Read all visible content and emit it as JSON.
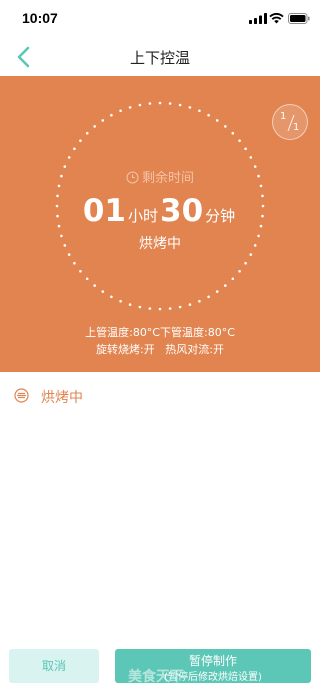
{
  "status": {
    "time": "10:07"
  },
  "nav": {
    "title": "上下控温"
  },
  "panel": {
    "page_current": "1",
    "page_total": "1",
    "remaining_label": "剩余时间",
    "hours": "01",
    "hours_unit": "小时",
    "minutes": "30",
    "minutes_unit": "分钟",
    "state": "烘烤中",
    "temp_line": "上管温度:80°C下管温度:80°C",
    "mode_line": "旋转烧烤:开   热风对流:开",
    "bg_color": "#e18450"
  },
  "stage": {
    "label": "烘烤中"
  },
  "buttons": {
    "cancel": "取消",
    "pause": "暂停制作",
    "pause_hint": "(暂停后修改烘焙设置)"
  },
  "watermark": "美食天下",
  "colors": {
    "accent": "#5cc7b6",
    "orange": "#e18450"
  }
}
